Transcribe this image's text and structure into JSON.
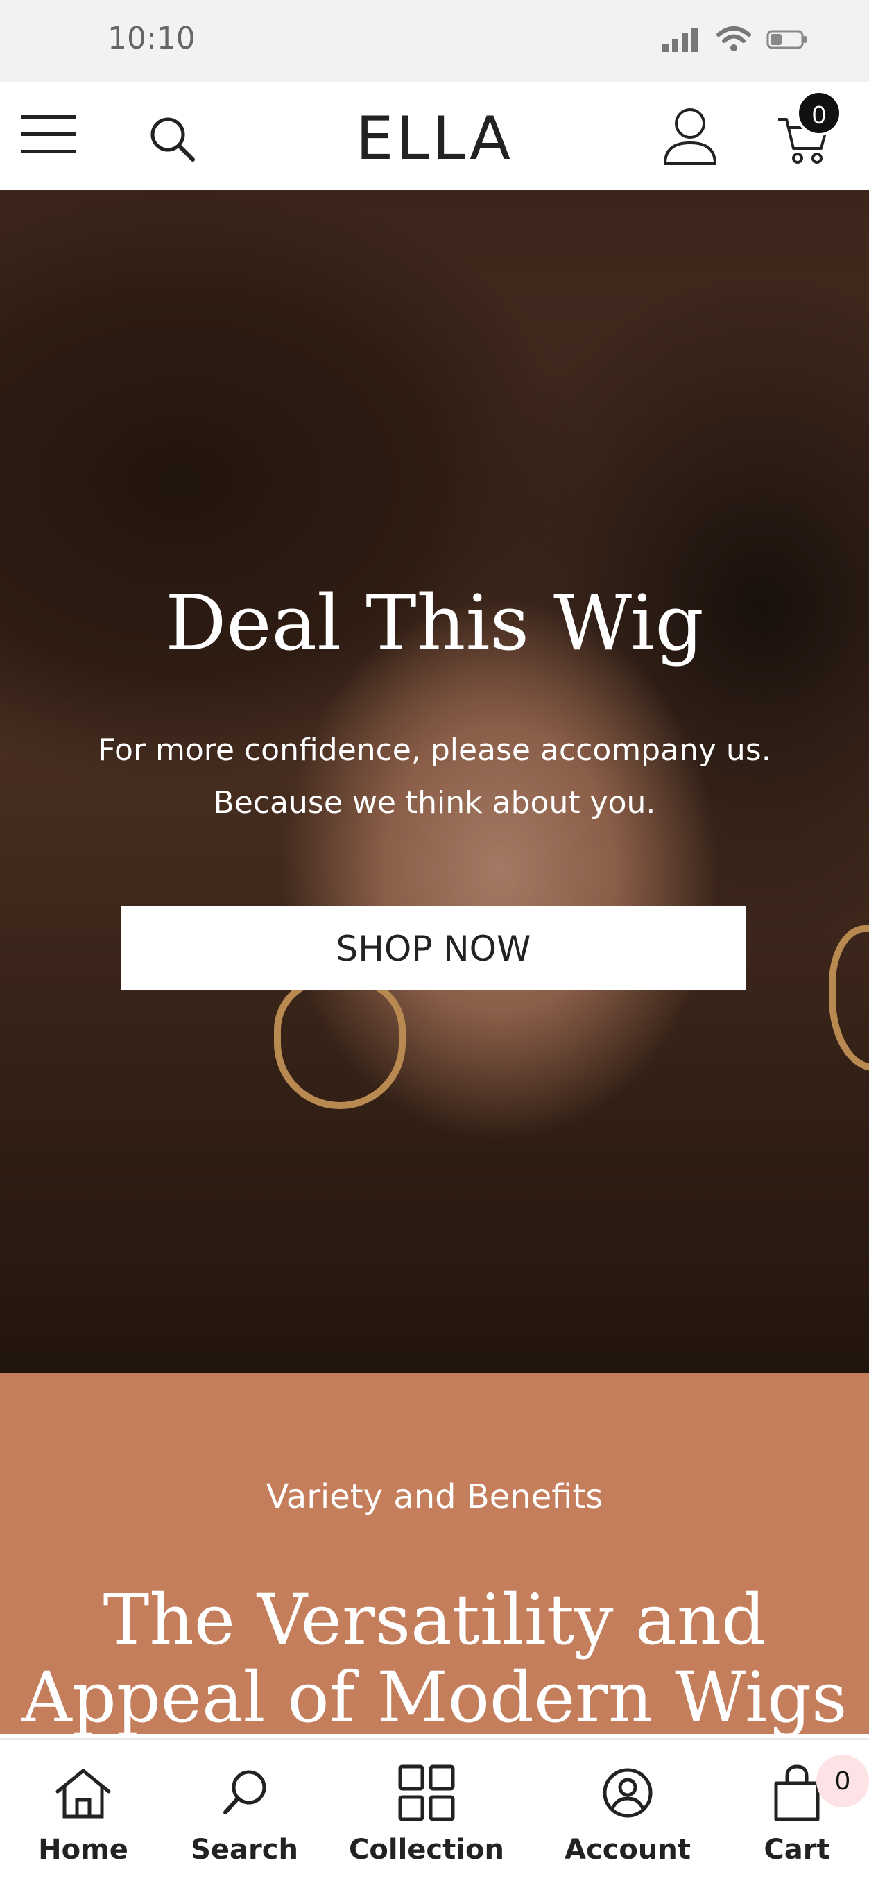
{
  "status_bar": {
    "time": "10:10"
  },
  "header": {
    "logo": "ELLA",
    "cart_count": "0"
  },
  "hero": {
    "title": "Deal This Wig",
    "subtitle_line1": "For more confidence, please accompany us.",
    "subtitle_line2": "Because we think about you.",
    "cta_label": "SHOP NOW"
  },
  "promo": {
    "eyebrow": "Variety and Benefits",
    "title_line1": "The Versatility and",
    "title_line2": "Appeal of Modern Wigs"
  },
  "bottom_nav": {
    "home": "Home",
    "search": "Search",
    "collection": "Collection",
    "account": "Account",
    "cart": "Cart",
    "cart_badge": "0"
  },
  "colors": {
    "promo_bg": "#c57e5c",
    "cart_badge_bg": "#111111",
    "nav_badge_bg": "#fde3e6"
  }
}
